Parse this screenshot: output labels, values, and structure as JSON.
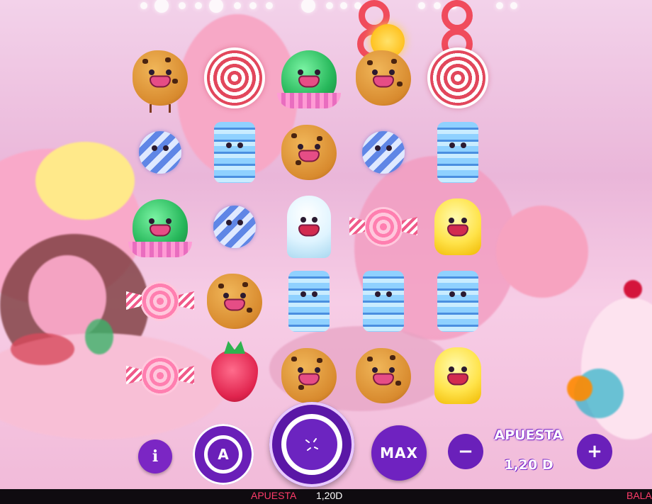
{
  "controls": {
    "info_label": "i",
    "autoplay_label": "A",
    "max_label": "MAX",
    "minus_label": "−",
    "plus_label": "+",
    "bet_title": "APUESTA",
    "bet_value": "1,20  D"
  },
  "status_bar": {
    "bet_label": "APUESTA",
    "bet_value": "1,20D",
    "balance_label": "BALA"
  },
  "reels": {
    "grid": [
      [
        "cookie",
        "swirl",
        "green-drop",
        "cookie",
        "swirl"
      ],
      [
        "blue-ball",
        "blue-spring",
        "cookie",
        "blue-ball",
        "blue-spring"
      ],
      [
        "green-drop",
        "blue-ball",
        "marshmallow",
        "wrapped-candy",
        "yellow-gumdrop"
      ],
      [
        "wrapped-candy",
        "cookie",
        "blue-spring",
        "blue-spring",
        "blue-spring"
      ],
      [
        "wrapped-candy",
        "raspberry",
        "cookie",
        "cookie",
        "yellow-gumdrop"
      ]
    ]
  },
  "colors": {
    "button_purple": "#6a20ba",
    "status_red": "#ff3c6a",
    "bar_bg": "#0f0b10"
  },
  "icons": [
    "info-icon",
    "autoplay-icon",
    "spin-icon",
    "minus-icon",
    "plus-icon"
  ]
}
